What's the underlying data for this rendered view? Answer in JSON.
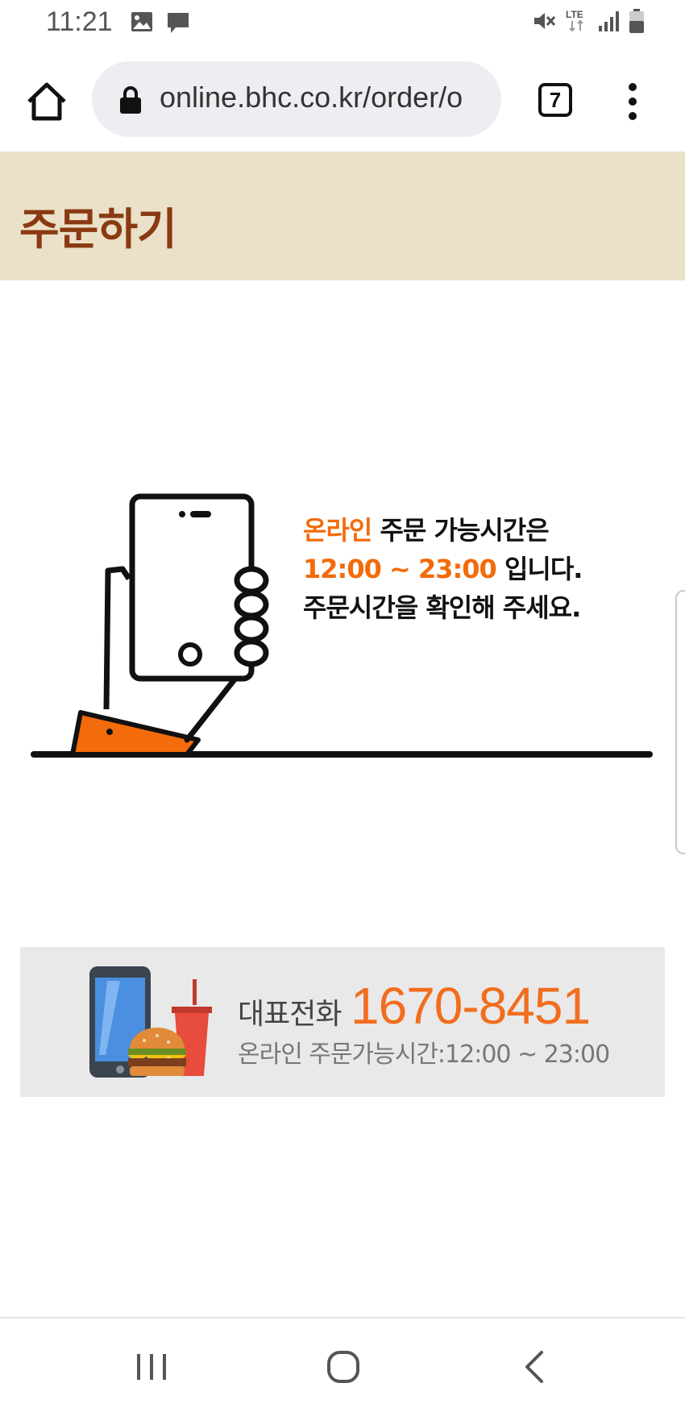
{
  "status_bar": {
    "time": "11:21",
    "network": "LTE",
    "icons": [
      "image-icon",
      "message-icon",
      "mute-icon",
      "lte-icon",
      "signal-icon",
      "battery-icon"
    ]
  },
  "browser": {
    "url": "online.bhc.co.kr/order/o",
    "tab_count": "7",
    "icons": [
      "home-icon",
      "lock-icon",
      "more-vert-icon"
    ]
  },
  "page": {
    "title": "주문하기"
  },
  "notice": {
    "line1_highlight": "온라인",
    "line1_rest": " 주문 가능시간은",
    "line2_highlight": "12:00 ~ 23:00",
    "line2_rest": " 입니다.",
    "line3": "주문시간을 확인해 주세요."
  },
  "banner": {
    "label": "대표전화",
    "phone": "1670-8451",
    "hours": "온라인 주문가능시간:12:00 ~ 23:00"
  },
  "nav": {
    "icons": [
      "recent-apps-icon",
      "home-circle-icon",
      "back-icon"
    ]
  },
  "colors": {
    "header_bg": "#ebe0c8",
    "title": "#8a3a12",
    "accent_orange": "#f36b0a",
    "banner_bg": "#e9e9e9"
  }
}
